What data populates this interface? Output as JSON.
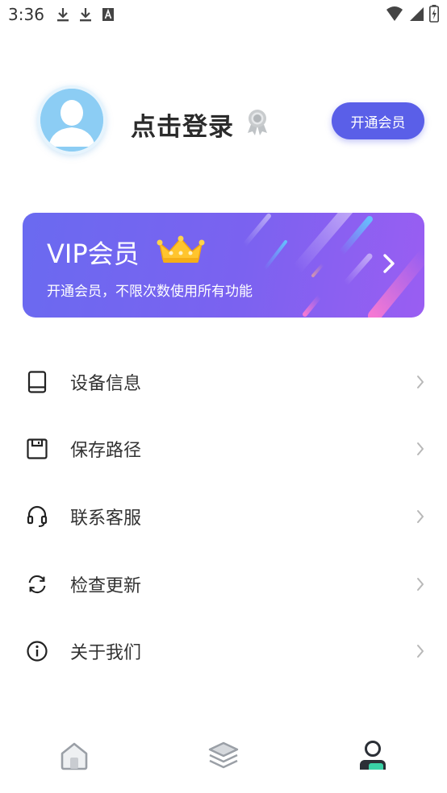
{
  "status_bar": {
    "time": "3:36"
  },
  "profile": {
    "login_text": "点击登录",
    "vip_button_label": "开通会员"
  },
  "vip_card": {
    "title": "VIP会员",
    "subtitle": "开通会员，不限次数使用所有功能"
  },
  "menu": {
    "items": [
      {
        "label": "设备信息",
        "icon": "phone-icon"
      },
      {
        "label": "保存路径",
        "icon": "save-icon"
      },
      {
        "label": "联系客服",
        "icon": "headset-icon"
      },
      {
        "label": "检查更新",
        "icon": "refresh-icon"
      },
      {
        "label": "关于我们",
        "icon": "info-icon"
      }
    ]
  },
  "bottom_nav": {
    "items": [
      {
        "icon": "home-icon",
        "active": false
      },
      {
        "icon": "layers-icon",
        "active": false
      },
      {
        "icon": "profile-icon",
        "active": true
      }
    ]
  },
  "colors": {
    "accent": "#5a5fe8",
    "vip_gradient_start": "#6a6af0",
    "vip_gradient_end": "#9a5ef2",
    "active_nav": "#3ad1a6"
  }
}
